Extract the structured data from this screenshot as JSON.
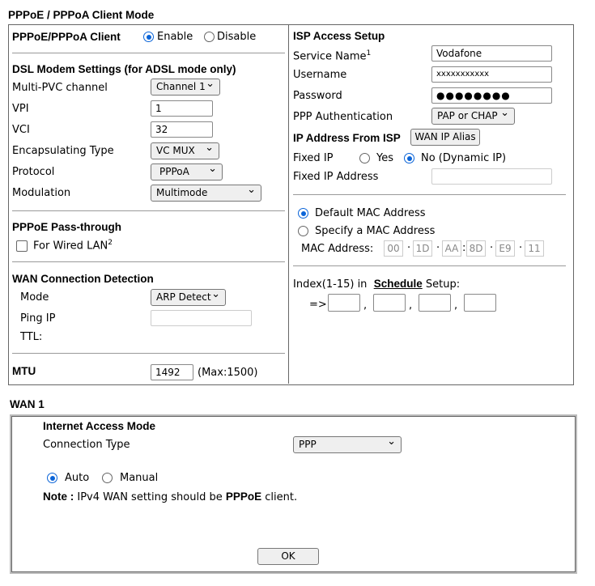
{
  "title": "PPPoE / PPPoA Client Mode",
  "client": {
    "label": "PPPoE/PPPoA Client",
    "enable": "Enable",
    "disable": "Disable",
    "selected": "Enable"
  },
  "dsl": {
    "heading": "DSL Modem Settings (for ADSL mode only)",
    "multipvc_label": "Multi-PVC channel",
    "multipvc": "Channel 1",
    "vpi_label": "VPI",
    "vpi": "1",
    "vci_label": "VCI",
    "vci": "32",
    "encap_label": "Encapsulating Type",
    "encap": "VC MUX",
    "protocol_label": "Protocol",
    "protocol": "PPPoA",
    "modulation_label": "Modulation",
    "modulation": "Multimode"
  },
  "passthrough": {
    "heading": "PPPoE Pass-through",
    "wired": "For Wired LAN",
    "sup": "2",
    "checked": false
  },
  "detection": {
    "heading": "WAN Connection Detection",
    "mode_label": "Mode",
    "mode": "ARP Detect",
    "ping_label": "Ping IP",
    "ping": "",
    "ttl_label": "TTL:"
  },
  "mtu": {
    "label": "MTU",
    "value": "1492",
    "hint": "(Max:1500)"
  },
  "isp": {
    "heading": "ISP Access Setup",
    "service_label": "Service Name",
    "service_sup": "1",
    "service": "Vodafone",
    "username_label": "Username",
    "username": "xxxxxxxxxxx",
    "password_label": "Password",
    "password": "●●●●●●●●",
    "auth_label": "PPP Authentication",
    "auth": "PAP or CHAP",
    "ipfrom_label": "IP Address From ISP",
    "wan_alias": "WAN IP Alias",
    "fixed_label": "Fixed IP",
    "yes": "Yes",
    "no": "No (Dynamic IP)",
    "fixed_selected": "No",
    "fixed_addr_label": "Fixed IP Address",
    "fixed_addr": ""
  },
  "mac": {
    "default": "Default MAC Address",
    "specify": "Specify a MAC Address",
    "selected": "Default",
    "label": "MAC Address:",
    "octets": [
      "00",
      "1D",
      "AA",
      "8D",
      "E9",
      "11"
    ]
  },
  "schedule": {
    "prefix": "Index(1-15) in",
    "link": "Schedule",
    "suffix": "Setup:",
    "arrow": "=>",
    "sep": ","
  },
  "wan": {
    "title": "WAN 1",
    "heading": "Internet Access Mode",
    "conn_label": "Connection Type",
    "conn": "PPP",
    "auto": "Auto",
    "manual": "Manual",
    "selected": "Auto",
    "note_bold": "Note :",
    "note_text": " IPv4 WAN setting should be ",
    "note_bold2": "PPPoE",
    "note_end": " client.",
    "ok": "OK"
  }
}
